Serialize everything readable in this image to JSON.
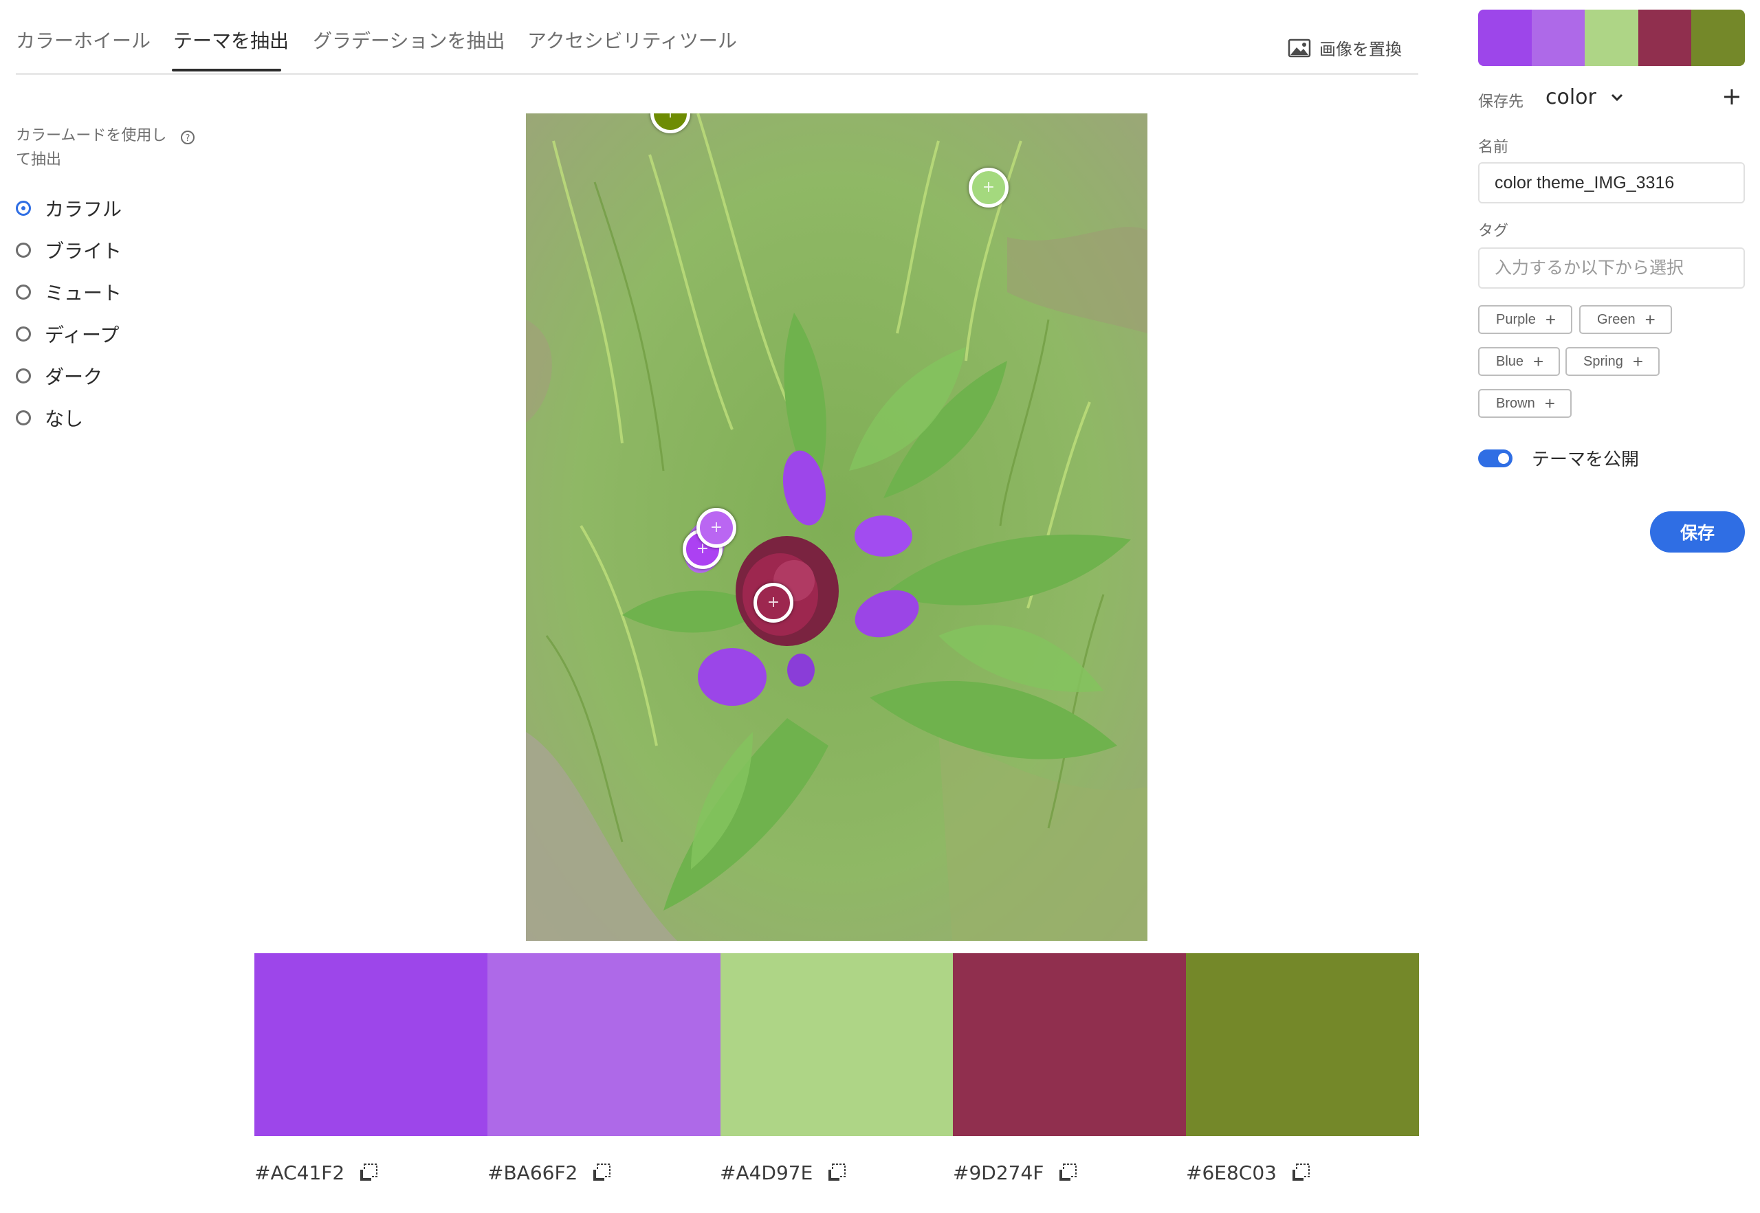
{
  "tabs": [
    "カラーホイール",
    "テーマを抽出",
    "グラデーションを抽出",
    "アクセシビリティツール"
  ],
  "active_tab": "テーマを抽出",
  "replace_image_label": "画像を置換",
  "mode_panel": {
    "label": "カラームードを使用して抽出",
    "options": [
      "カラフル",
      "ブライト",
      "ミュート",
      "ディープ",
      "ダーク",
      "なし"
    ],
    "selected": "カラフル"
  },
  "theme_colors": [
    {
      "hex": "#AC41F2",
      "display": "#9D46EA"
    },
    {
      "hex": "#BA66F2",
      "display": "#AE69E8"
    },
    {
      "hex": "#A4D97E",
      "display": "#AED586"
    },
    {
      "hex": "#9D274F",
      "display": "#902F4E"
    },
    {
      "hex": "#6E8C03",
      "display": "#748829"
    }
  ],
  "save_panel": {
    "save_to_label": "保存先",
    "save_to_value": "color",
    "name_label": "名前",
    "name_value": "color theme_IMG_3316",
    "tag_label": "タグ",
    "tag_placeholder": "入力するか以下から選択",
    "tags": [
      "Purple",
      "Green",
      "Blue",
      "Spring",
      "Brown"
    ],
    "publish_label": "テーマを公開",
    "publish_on": true,
    "save_button": "保存"
  },
  "icons": {
    "replace": "image-icon",
    "help": "help-icon",
    "copy": "copy-icon",
    "add": "plus-icon",
    "dropdown": "chevron-down-icon"
  }
}
